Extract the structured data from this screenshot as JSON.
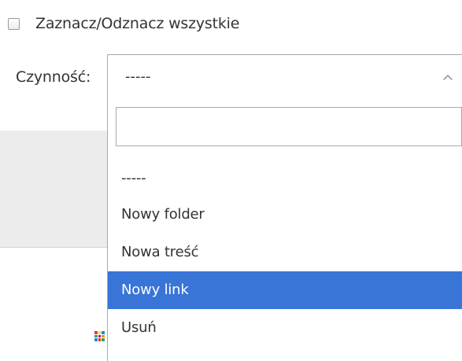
{
  "select_all": {
    "label": "Zaznacz/Odznacz wszystkie",
    "checked": false
  },
  "action": {
    "label": "Czynność:",
    "selected_value": "-----",
    "search_value": "",
    "options": [
      {
        "label": "-----",
        "highlighted": false
      },
      {
        "label": "Nowy folder",
        "highlighted": false
      },
      {
        "label": "Nowa treść",
        "highlighted": false
      },
      {
        "label": "Nowy link",
        "highlighted": true
      },
      {
        "label": "Usuń",
        "highlighted": false
      }
    ]
  },
  "colors": {
    "highlight": "#3875d7",
    "border": "#a8a8a8",
    "text": "#333333",
    "panel": "#ececec"
  },
  "icons": {
    "chevron": "chevron-up-icon",
    "checkbox": "checkbox-unchecked-icon"
  }
}
